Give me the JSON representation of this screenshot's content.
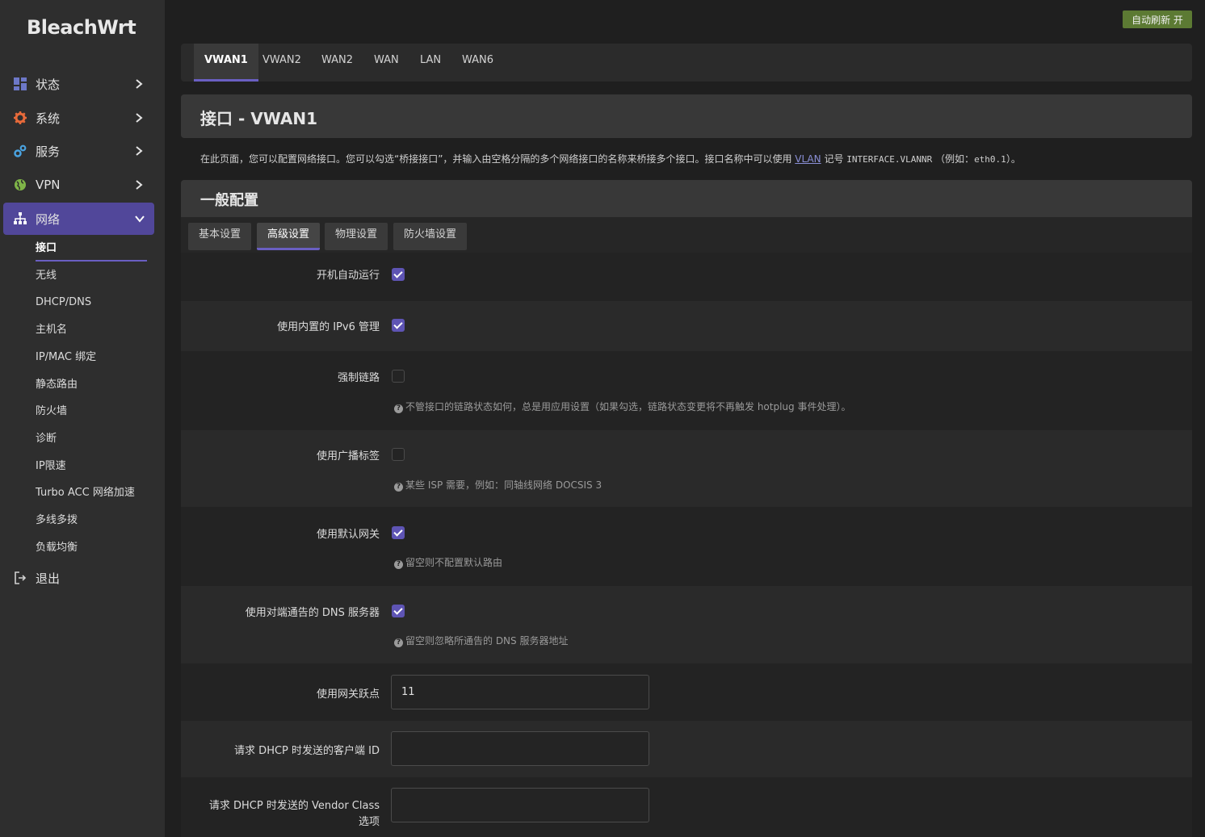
{
  "brand": "BleachWrt",
  "auto_refresh": "自动刷新 开",
  "sidebar": {
    "items": [
      {
        "label": "状态"
      },
      {
        "label": "系统"
      },
      {
        "label": "服务"
      },
      {
        "label": "VPN"
      },
      {
        "label": "网络"
      },
      {
        "label": "退出"
      }
    ],
    "network_sub": [
      {
        "label": "接口"
      },
      {
        "label": "无线"
      },
      {
        "label": "DHCP/DNS"
      },
      {
        "label": "主机名"
      },
      {
        "label": "IP/MAC 绑定"
      },
      {
        "label": "静态路由"
      },
      {
        "label": "防火墙"
      },
      {
        "label": "诊断"
      },
      {
        "label": "IP限速"
      },
      {
        "label": "Turbo ACC 网络加速"
      },
      {
        "label": "多线多拨"
      },
      {
        "label": "负载均衡"
      }
    ]
  },
  "top_tabs": [
    {
      "label": "VWAN1"
    },
    {
      "label": "VWAN2"
    },
    {
      "label": "WAN2"
    },
    {
      "label": "WAN"
    },
    {
      "label": "LAN"
    },
    {
      "label": "WAN6"
    }
  ],
  "page_title": "接口 - VWAN1",
  "description": {
    "part1": "在此页面，您可以配置网络接口。您可以勾选“桥接接口”，并输入由空格分隔的多个网络接口的名称来桥接多个接口。接口名称中可以使用 ",
    "link": "VLAN",
    "part2": " 记号 ",
    "code1": "INTERFACE.VLANNR",
    "part3": " （例如：",
    "code2": "eth0.1",
    "part4": "）。"
  },
  "general": {
    "title": "一般配置",
    "tabs": [
      {
        "label": "基本设置"
      },
      {
        "label": "高级设置"
      },
      {
        "label": "物理设置"
      },
      {
        "label": "防火墙设置"
      }
    ]
  },
  "fields": {
    "autostart": {
      "label": "开机自动运行",
      "checked": true
    },
    "ipv6": {
      "label": "使用内置的 IPv6 管理",
      "checked": true
    },
    "force_link": {
      "label": "强制链路",
      "checked": false,
      "help": "不管接口的链路状态如何，总是用应用设置（如果勾选，链路状态变更将不再触发 hotplug 事件处理）。"
    },
    "broadcast": {
      "label": "使用广播标签",
      "checked": false,
      "help": "某些 ISP 需要，例如：同轴线网络 DOCSIS 3"
    },
    "default_gw": {
      "label": "使用默认网关",
      "checked": true,
      "help": "留空则不配置默认路由"
    },
    "peer_dns": {
      "label": "使用对端通告的 DNS 服务器",
      "checked": true,
      "help": "留空则忽略所通告的 DNS 服务器地址"
    },
    "metric": {
      "label": "使用网关跃点",
      "value": "11"
    },
    "client_id": {
      "label": "请求 DHCP 时发送的客户端 ID",
      "value": ""
    },
    "vendor_class": {
      "label1": "请求 DHCP 时发送的 Vendor Class",
      "label2": "选项",
      "value": ""
    }
  },
  "colors": {
    "accent": "#6a5fc2",
    "active_nav": "#51479a",
    "refresh_badge": "#5c7a33"
  }
}
